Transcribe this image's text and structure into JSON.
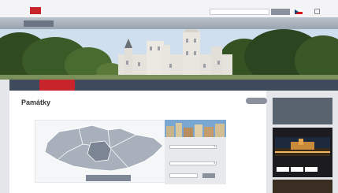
{
  "header": {
    "portal_name": "",
    "search_placeholder": "",
    "search_button": "",
    "lang": ""
  },
  "nav": {
    "items": [
      "",
      "",
      "",
      ""
    ],
    "right": ""
  },
  "secondary_nav": {
    "items": [
      "",
      "",
      "",
      "",
      "",
      "",
      ""
    ],
    "active_index": 1
  },
  "main": {
    "breadcrumb": "",
    "title": "Památky",
    "back_button": "",
    "map_caption": ""
  },
  "filter": {
    "label_1": "",
    "select_1": "",
    "label_2": "",
    "select_2": "",
    "search_button": ""
  },
  "sidebar": {
    "links": [
      "",
      "",
      "",
      ""
    ],
    "promo_title": "",
    "promo_text": "",
    "promo_buttons": [
      "",
      "",
      ""
    ],
    "promo2_title": ""
  },
  "colors": {
    "brand_red": "#c8242b",
    "nav_dark": "#3f4a5a",
    "accent_gray": "#8a909c"
  }
}
